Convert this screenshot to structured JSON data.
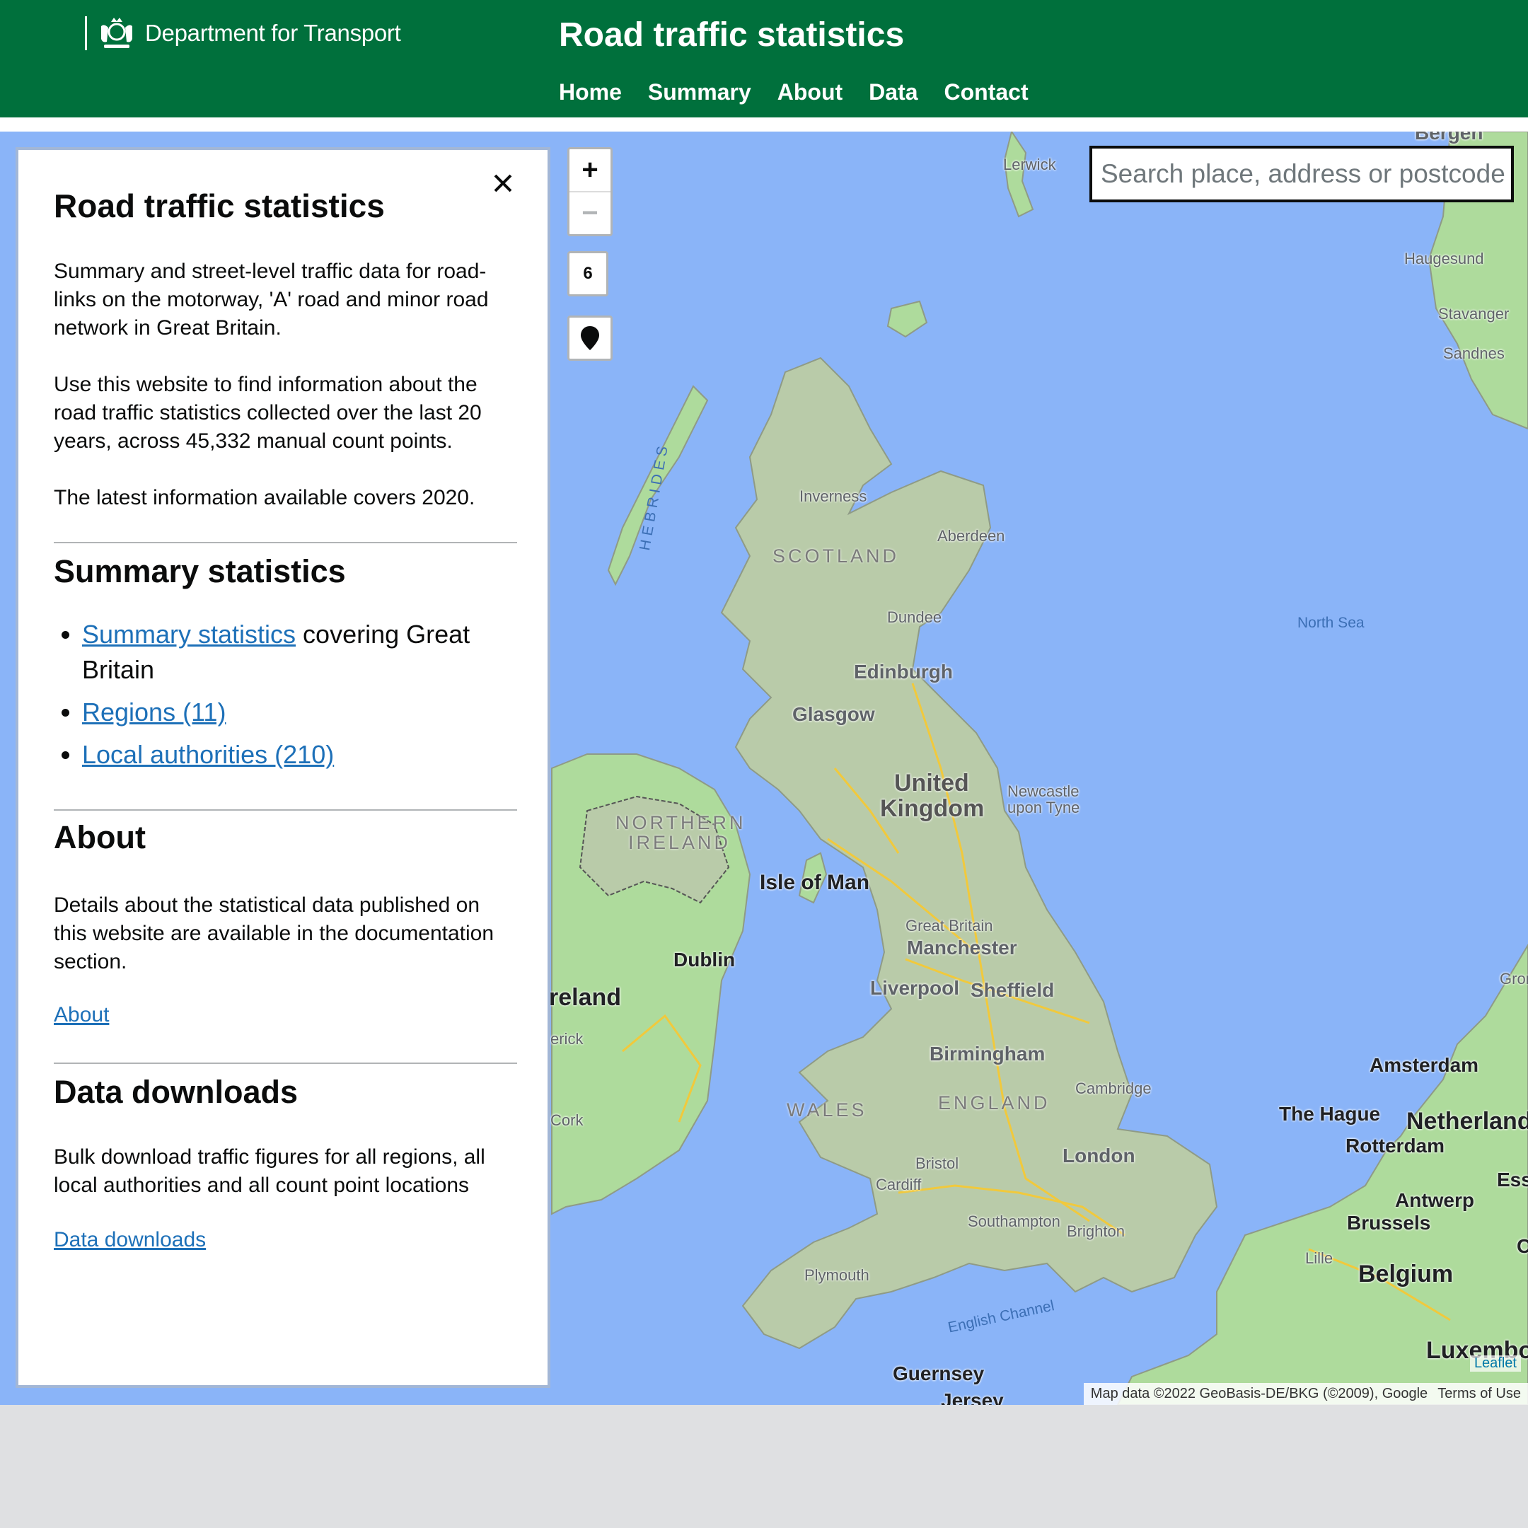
{
  "header": {
    "department": "Department for Transport",
    "site_title": "Road traffic statistics",
    "nav": [
      "Home",
      "Summary",
      "About",
      "Data",
      "Contact"
    ]
  },
  "panel": {
    "title": "Road traffic statistics",
    "intro_1": "Summary and street-level traffic data for road-links on the motorway, 'A' road and minor road network in Great Britain.",
    "intro_2": "Use this website to find information about the road traffic statistics collected over the last 20 years, across 45,332 manual count points.",
    "intro_3": "The latest information available covers 2020.",
    "summary_heading": "Summary statistics",
    "summary_items": [
      {
        "link": "Summary statistics",
        "suffix": " covering Great Britain"
      },
      {
        "link": "Regions (11)",
        "suffix": ""
      },
      {
        "link": "Local authorities (210)",
        "suffix": ""
      }
    ],
    "about_heading": "About",
    "about_text": "Details about the statistical data published on this website are available in the documentation section.",
    "about_link": "About",
    "downloads_heading": "Data downloads",
    "downloads_text": "Bulk download traffic figures for all regions, all local authorities and all count point locations",
    "downloads_link": "Data downloads"
  },
  "map": {
    "zoom_in": "+",
    "zoom_out": "−",
    "zoom_level": "6",
    "search_placeholder": "Search place, address or postcode",
    "attribution": "Map data ©2022 GeoBasis-DE/BKG (©2009), Google",
    "terms": "Terms of Use",
    "leaflet": "Leaflet",
    "labels": {
      "lerwick": "Lerwick",
      "bergen": "Bergen",
      "haugesund": "Haugesund",
      "stavanger": "Stavanger",
      "sandnes": "Sandnes",
      "inverness": "Inverness",
      "aberdeen": "Aberdeen",
      "scotland": "SCOTLAND",
      "hebrides": "HEBRIDES",
      "dundee": "Dundee",
      "north_sea": "North Sea",
      "edinburgh": "Edinburgh",
      "glasgow": "Glasgow",
      "united": "United",
      "kingdom": "Kingdom",
      "newcastle_1": "Newcastle",
      "newcastle_2": "upon Tyne",
      "northern": "NORTHERN",
      "ireland_region": "IRELAND",
      "isle_of_man": "Isle of Man",
      "great_britain": "Great Britain",
      "manchester": "Manchester",
      "dublin": "Dublin",
      "ireland": "reland",
      "liverpool": "Liverpool",
      "sheffield": "Sheffield",
      "groningen": "Groni",
      "limerick": "erick",
      "birmingham": "Birmingham",
      "amsterdam": "Amsterdam",
      "cambridge": "Cambridge",
      "the_hague": "The Hague",
      "netherlands": "Netherland",
      "wales": "WALES",
      "england": "ENGLAND",
      "cork": "Cork",
      "rotterdam": "Rotterdam",
      "london": "London",
      "bristol": "Bristol",
      "cardiff": "Cardiff",
      "essen": "Ess",
      "antwerp": "Antwerp",
      "brussels": "Brussels",
      "southampton": "Southampton",
      "brighton": "Brighton",
      "lille": "Lille",
      "belgium": "Belgium",
      "plymouth": "Plymouth",
      "english_channel": "English Channel",
      "luxembourg": "Luxembo",
      "guernsey": "Guernsey",
      "jersey": "Jersey",
      "cologne": "C"
    }
  }
}
